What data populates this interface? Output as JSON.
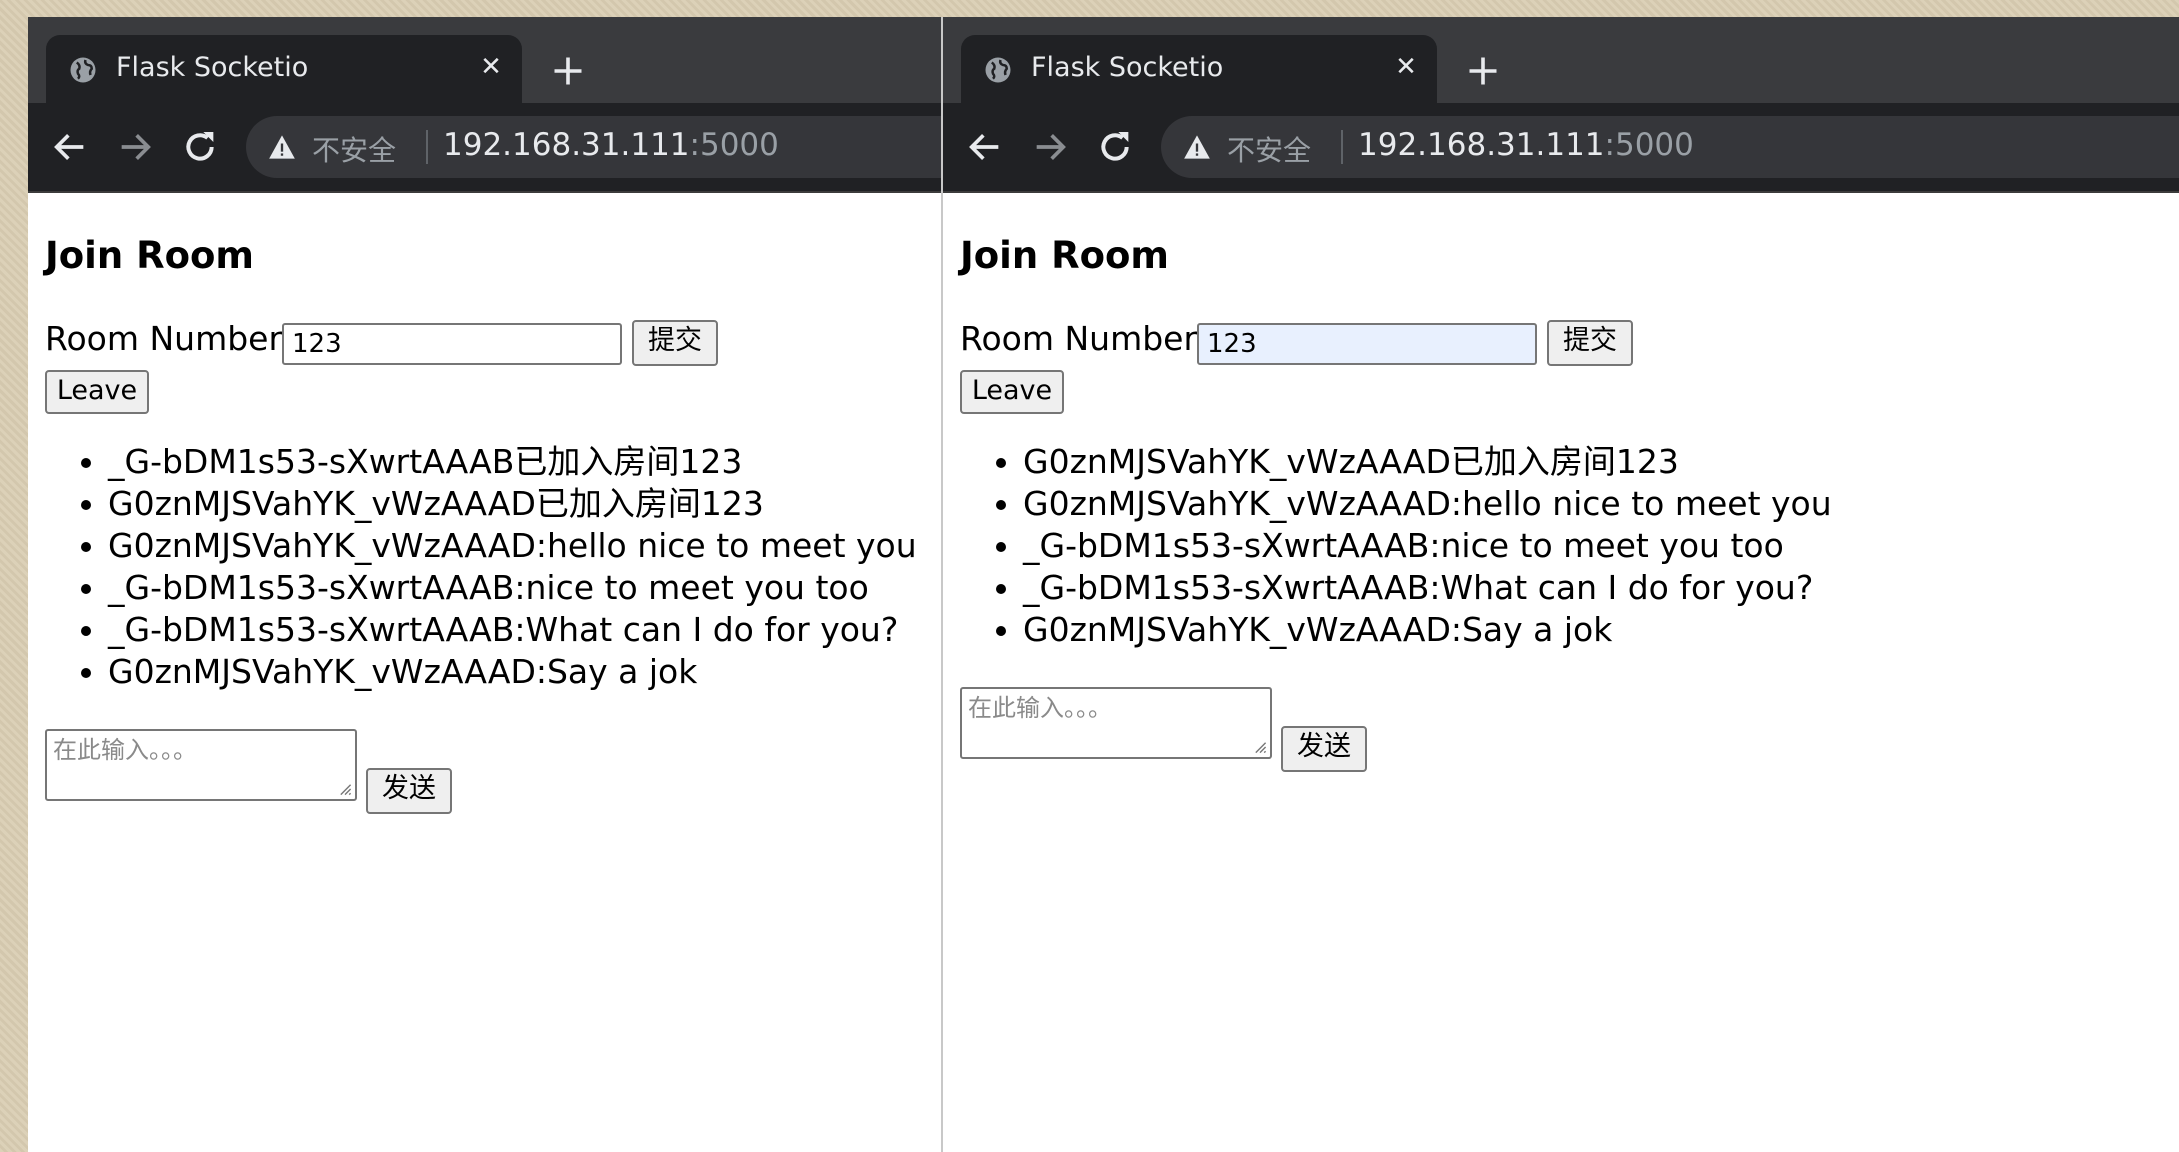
{
  "windows": [
    {
      "tab_title": "Flask Socketio",
      "tab_close_glyph": "✕",
      "security_label": "不安全",
      "url_host": "192.168.31.111",
      "url_port": ":5000",
      "heading": "Join Room",
      "room_label": "Room Number",
      "room_value": "123",
      "submit_label": "提交",
      "leave_label": "Leave",
      "messages": [
        "_G-bDM1s53-sXwrtAAAB已加入房间123",
        "G0znMJSVahYK_vWzAAAD已加入房间123",
        "G0znMJSVahYK_vWzAAAD:hello nice to meet you",
        "_G-bDM1s53-sXwrtAAAB:nice to meet you too",
        "_G-bDM1s53-sXwrtAAAB:What can I do for you?",
        "G0znMJSVahYK_vWzAAAD:Say a jok"
      ],
      "chat_placeholder": "在此输入。。。",
      "send_label": "发送",
      "icons": [
        "globe-icon",
        "close-icon",
        "new-tab-icon",
        "back-arrow-icon",
        "forward-arrow-icon",
        "reload-icon",
        "warning-icon"
      ]
    },
    {
      "tab_title": "Flask Socketio",
      "tab_close_glyph": "✕",
      "security_label": "不安全",
      "url_host": "192.168.31.111",
      "url_port": ":5000",
      "heading": "Join Room",
      "room_label": "Room Number",
      "room_value": "123",
      "submit_label": "提交",
      "leave_label": "Leave",
      "messages": [
        "G0znMJSVahYK_vWzAAAD已加入房间123",
        "G0znMJSVahYK_vWzAAAD:hello nice to meet you",
        "_G-bDM1s53-sXwrtAAAB:nice to meet you too",
        "_G-bDM1s53-sXwrtAAAB:What can I do for you?",
        "G0znMJSVahYK_vWzAAAD:Say a jok"
      ],
      "chat_placeholder": "在此输入。。。",
      "send_label": "发送",
      "icons": [
        "globe-icon",
        "close-icon",
        "new-tab-icon",
        "back-arrow-icon",
        "forward-arrow-icon",
        "reload-icon",
        "warning-icon"
      ]
    }
  ],
  "colors": {
    "chrome_dark": "#202124",
    "tabstrip": "#3a3b3e",
    "omnibox": "#35363a",
    "text_light": "#e8eaed",
    "text_muted": "#9aa0a6",
    "autofill_bg": "#e8f0fe",
    "button_bg": "#efefef",
    "border": "#767676"
  }
}
